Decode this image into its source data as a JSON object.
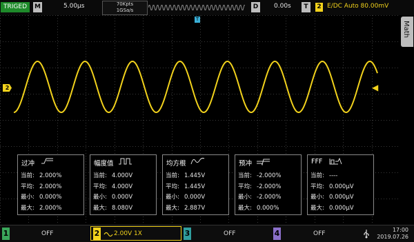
{
  "topbar": {
    "trig_status": "TRIGED",
    "m_label": "M",
    "timebase": "5.00µs",
    "mem_depth": "70Kpts",
    "sample_rate": "1GSa/s",
    "d_label": "D",
    "delay": "0.00s",
    "t_label": "T",
    "trig_channel": "2",
    "trig_info": "E∕DC Auto 80.00mV"
  },
  "side_tab": {
    "label": "Math"
  },
  "markers": {
    "ch2_level": "2",
    "trigger_marker": "T"
  },
  "measurements": [
    {
      "title": "过冲",
      "rows": [
        {
          "label": "当前:",
          "value": "2.000%"
        },
        {
          "label": "平均:",
          "value": "2.000%"
        },
        {
          "label": "最小:",
          "value": "0.000%"
        },
        {
          "label": "最大:",
          "value": "2.000%"
        }
      ]
    },
    {
      "title": "幅度值",
      "rows": [
        {
          "label": "当前:",
          "value": "4.000V"
        },
        {
          "label": "平均:",
          "value": "4.000V"
        },
        {
          "label": "最小:",
          "value": "0.000V"
        },
        {
          "label": "最大:",
          "value": "8.080V"
        }
      ]
    },
    {
      "title": "均方根",
      "rows": [
        {
          "label": "当前:",
          "value": "1.445V"
        },
        {
          "label": "平均:",
          "value": "1.445V"
        },
        {
          "label": "最小:",
          "value": "0.000V"
        },
        {
          "label": "最大:",
          "value": "2.887V"
        }
      ]
    },
    {
      "title": "预冲",
      "rows": [
        {
          "label": "当前:",
          "value": "-2.000%"
        },
        {
          "label": "平均:",
          "value": "-2.000%"
        },
        {
          "label": "最小:",
          "value": "-2.000%"
        },
        {
          "label": "最大:",
          "value": "0.000%"
        }
      ]
    },
    {
      "title": "FFF",
      "rows": [
        {
          "label": "当前:",
          "value": "----"
        },
        {
          "label": "平均:",
          "value": "0.000µV"
        },
        {
          "label": "最小:",
          "value": "0.000µV"
        },
        {
          "label": "最大:",
          "value": "0.000µV"
        }
      ]
    }
  ],
  "channels": [
    {
      "num": "1",
      "text": "OFF",
      "color": "#3aa65a"
    },
    {
      "num": "2",
      "text": "2.00V 1X",
      "color": "#f2d21c"
    },
    {
      "num": "3",
      "text": "OFF",
      "color": "#2f9e9e"
    },
    {
      "num": "4",
      "text": "OFF",
      "color": "#8a6fc9"
    }
  ],
  "clock": {
    "time": "17:00",
    "date": "2019.07.26"
  },
  "colors": {
    "trace": "#f2d21c",
    "grid": "#3a3a3a",
    "trig_green": "#1e8a2a"
  },
  "icons": [
    "usb-icon",
    "overshoot-icon",
    "amplitude-icon",
    "rms-icon",
    "preshoot-icon",
    "fff-icon"
  ]
}
